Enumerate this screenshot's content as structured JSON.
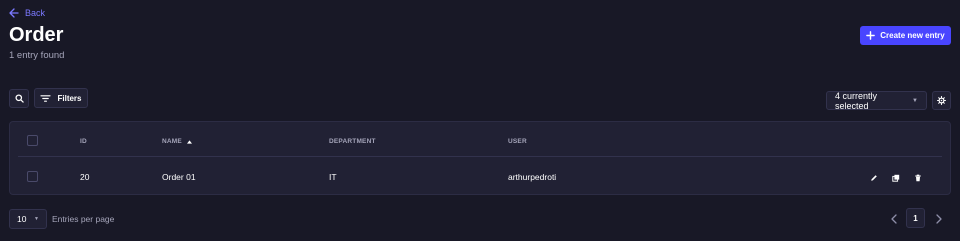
{
  "header": {
    "back_label": "Back",
    "title": "Order",
    "subtitle": "1 entry found",
    "create_label": "Create new entry"
  },
  "toolbar": {
    "filters_label": "Filters",
    "columns_select_value": "4 currently selected"
  },
  "table": {
    "columns": [
      "ID",
      "NAME",
      "DEPARTMENT",
      "USER"
    ],
    "sorted_column": "NAME",
    "rows": [
      {
        "id": "20",
        "name": "Order 01",
        "department": "IT",
        "user": "arthurpedroti"
      }
    ]
  },
  "footer": {
    "page_size": "10",
    "page_size_label": "Entries per page",
    "current_page": "1"
  },
  "colors": {
    "background": "#181826",
    "surface": "#212134",
    "border": "#32324d",
    "accent": "#4945ff",
    "link": "#7b79ff",
    "muted_text": "#a5a5ba"
  },
  "icons": [
    "arrow-left-icon",
    "plus-icon",
    "search-icon",
    "filter-icon",
    "sort-up-icon",
    "gear-icon",
    "pencil-icon",
    "duplicate-icon",
    "trash-icon",
    "chevron-left-icon",
    "chevron-right-icon"
  ]
}
